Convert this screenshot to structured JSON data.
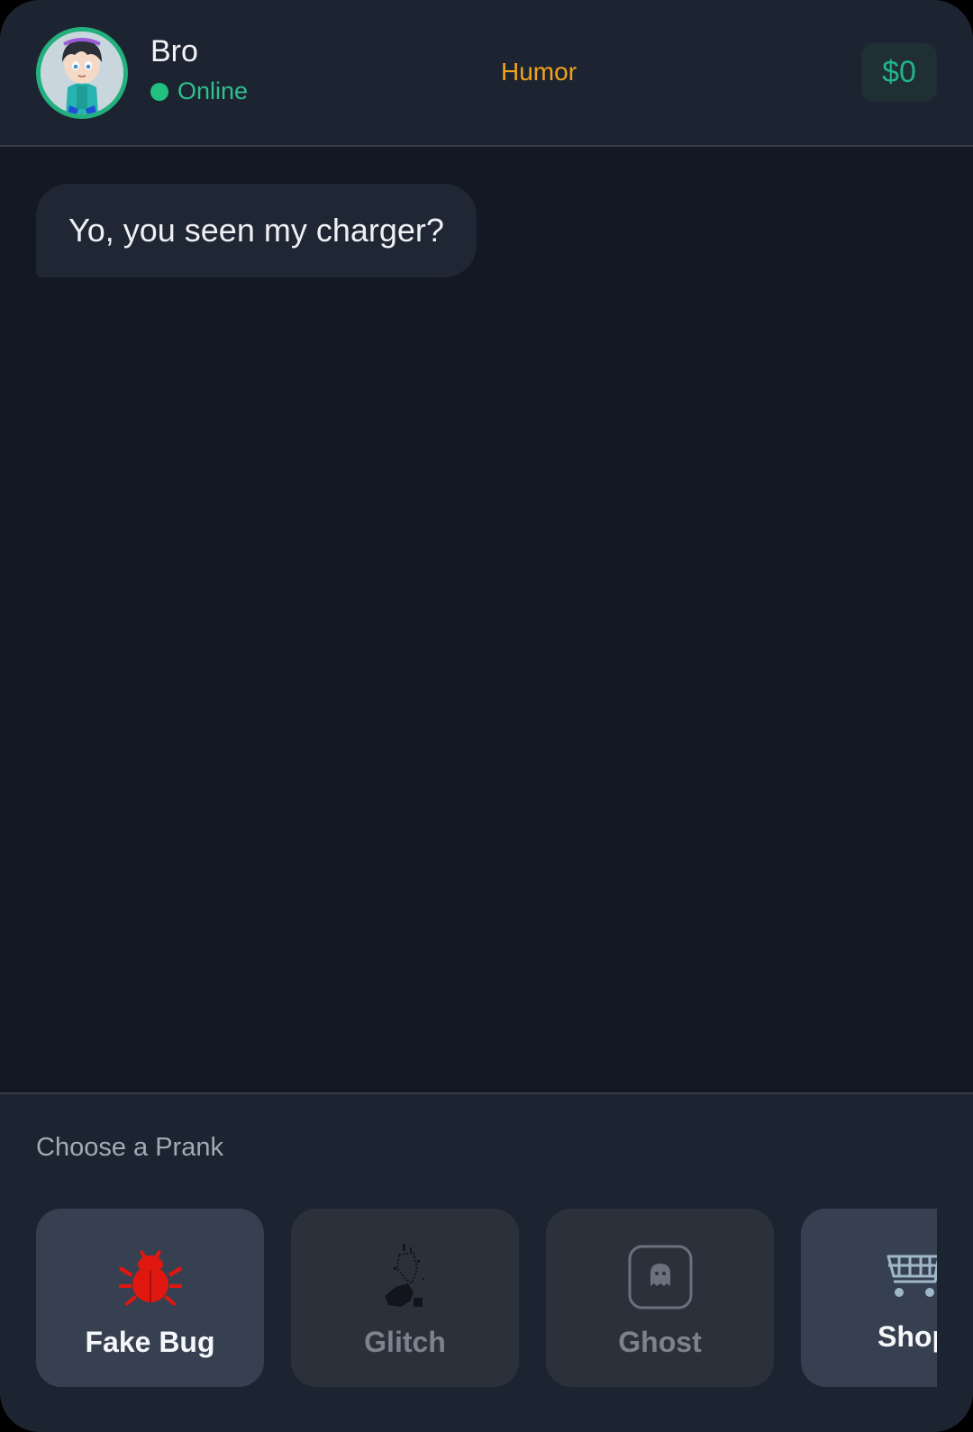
{
  "header": {
    "contact_name": "Bro",
    "status": "Online",
    "category": "Humor",
    "balance": "$0"
  },
  "chat": {
    "messages": [
      {
        "text": "Yo, you seen my charger?"
      }
    ]
  },
  "pranks": {
    "title": "Choose a Prank",
    "items": [
      {
        "label": "Fake Bug",
        "icon": "bug-icon",
        "state": "active"
      },
      {
        "label": "Glitch",
        "icon": "glitch-icon",
        "state": "disabled"
      },
      {
        "label": "Ghost",
        "icon": "ghost-icon",
        "state": "disabled"
      },
      {
        "label": "Shop",
        "icon": "shopping-cart-icon",
        "state": "available"
      }
    ]
  },
  "colors": {
    "accent_green": "#22b07d",
    "category_orange": "#f0a21c",
    "bug_red": "#e0170f"
  }
}
